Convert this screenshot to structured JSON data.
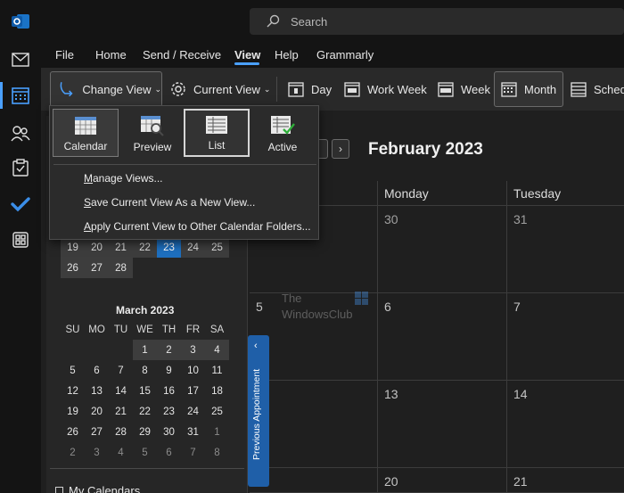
{
  "app": {
    "logo_icon": "outlook-logo-icon",
    "accent_color": "#4aa0ff"
  },
  "rail": {
    "items": [
      {
        "name": "mail-icon"
      },
      {
        "name": "calendar-icon",
        "active": true
      },
      {
        "name": "people-icon"
      },
      {
        "name": "tasks-icon"
      },
      {
        "name": "todo-icon"
      },
      {
        "name": "apps-icon"
      }
    ]
  },
  "search": {
    "placeholder": "Search"
  },
  "menu": {
    "tabs": [
      {
        "label": "File"
      },
      {
        "label": "Home"
      },
      {
        "label": "Send / Receive"
      },
      {
        "label": "View",
        "active": true
      },
      {
        "label": "Help"
      },
      {
        "label": "Grammarly"
      }
    ]
  },
  "ribbon": {
    "change_view": "Change View",
    "current_view": "Current View",
    "day": "Day",
    "work_week": "Work Week",
    "week": "Week",
    "month": "Month",
    "schedule": "Sched"
  },
  "popup": {
    "tiles": [
      {
        "label": "Calendar"
      },
      {
        "label": "Preview"
      },
      {
        "label": "List"
      },
      {
        "label": "Active"
      }
    ],
    "items": [
      {
        "ul": "M",
        "rest": "anage Views..."
      },
      {
        "ul": "S",
        "rest": "ave Current View As a New View..."
      },
      {
        "ul": "A",
        "rest": "pply Current View to Other Calendar Folders..."
      }
    ]
  },
  "mini_feb": {
    "rows": [
      [
        "19",
        "20",
        "21",
        "22",
        "23",
        "24",
        "25"
      ],
      [
        "26",
        "27",
        "28"
      ]
    ],
    "today": "23"
  },
  "mini_march": {
    "title": "March 2023",
    "headers": [
      "SU",
      "MO",
      "TU",
      "WE",
      "TH",
      "FR",
      "SA"
    ],
    "rows": [
      [
        "",
        "",
        "",
        "1",
        "2",
        "3",
        "4"
      ],
      [
        "5",
        "6",
        "7",
        "8",
        "9",
        "10",
        "11"
      ],
      [
        "12",
        "13",
        "14",
        "15",
        "16",
        "17",
        "18"
      ],
      [
        "19",
        "20",
        "21",
        "22",
        "23",
        "24",
        "25"
      ],
      [
        "26",
        "27",
        "28",
        "29",
        "30",
        "31",
        "1"
      ],
      [
        "2",
        "3",
        "4",
        "5",
        "6",
        "7",
        "8"
      ]
    ]
  },
  "my_calendars": "My Calendars",
  "previous_appointment": "Previous Appointment",
  "main": {
    "month_title": "February 2023",
    "columns": [
      "Monday",
      "Tuesday"
    ],
    "row_left_nums": [
      "",
      "5",
      "",
      ""
    ],
    "rows": [
      [
        "30",
        "31"
      ],
      [
        "6",
        "7"
      ],
      [
        "13",
        "14"
      ],
      [
        "20",
        "21"
      ]
    ]
  },
  "watermark": {
    "line1": "The",
    "line2": "WindowsClub"
  }
}
